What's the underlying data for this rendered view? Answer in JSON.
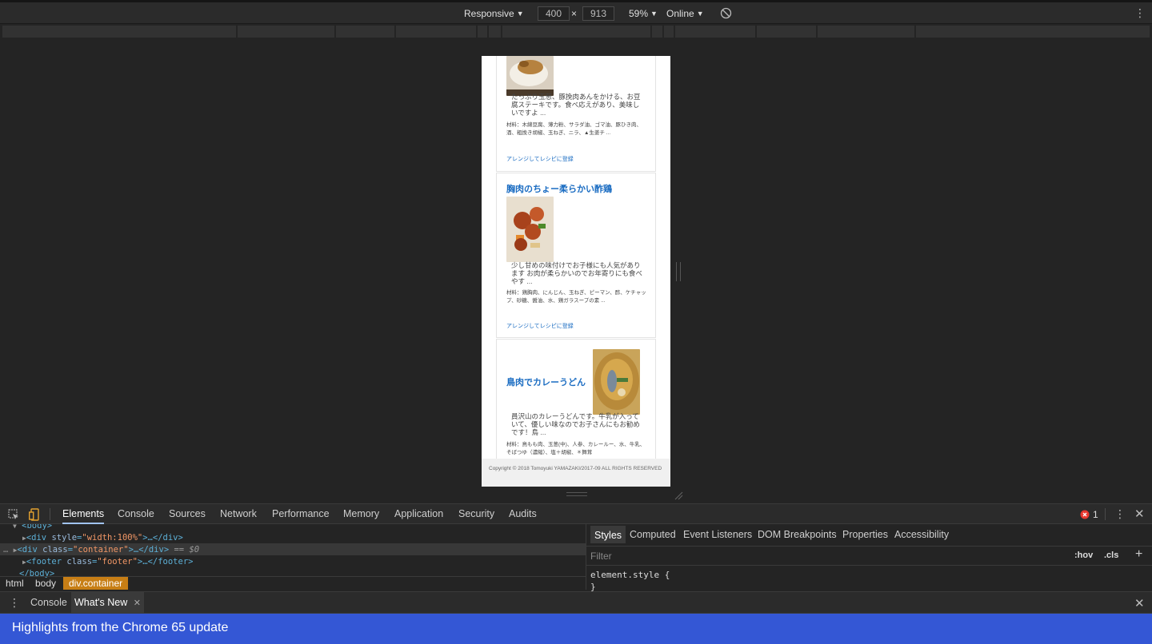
{
  "device_toolbar": {
    "device": "Responsive",
    "width": "400",
    "times": "×",
    "height": "913",
    "zoom": "59%",
    "network": "Online",
    "caret": "▼"
  },
  "page": {
    "cards": [
      {
        "description": "たっぷり玉葱、豚挽肉あんをかける、お豆腐ステーキです。食べ応えがあり、美味しいですよ ...",
        "ingredients": "材料：木綿豆腐、薄力粉、サラダ油、ゴマ油、豚ひき肉、酒、粗挽き胡椒、玉ねぎ、ニラ、▲生姜チ ...",
        "link": "アレンジしてレシピに登録"
      },
      {
        "title": "胸肉のちょー柔らかい酢鶏",
        "description": "少し甘めの味付けでお子様にも人気があります お肉が柔らかいのでお年寄りにも食べやす ...",
        "ingredients": "材料：鶏胸肉、にんじん、玉ねぎ、ピーマン、酢、ケチャップ、砂糖、醤油、水、鶏ガラスープの素 ...",
        "link": "アレンジしてレシピに登録"
      },
      {
        "title": "鳥肉でカレーうどん",
        "description": "員沢山のカレーうどんです。牛乳が入っていて、優しい味なのでお子さんにもお勧めです！鳥 ...",
        "ingredients": "材料：鳥もも肉、玉葱(中)、人参、カレールー、水、牛乳、そばつゆ（濃縮）、塩＋胡椒、＊舞茸"
      }
    ],
    "footer": "Copyright © 2018 Tomoyuki YAMAZAKI/2017-09 ALL RIGHTS RESERVED"
  },
  "devtools": {
    "tabs": [
      "Elements",
      "Console",
      "Sources",
      "Network",
      "Performance",
      "Memory",
      "Application",
      "Security",
      "Audits"
    ],
    "error_count": "1",
    "dom": {
      "line0": "<body>",
      "line1_tag_open": "<div ",
      "line1_attr": "style",
      "line1_val": "\"width:100%\"",
      "line1_rest": ">…</div>",
      "line2_tag_open": "<div ",
      "line2_attr": "class",
      "line2_val": "\"container\"",
      "line2_rest": ">…</div>",
      "line2_marker": " == $0",
      "line3_tag_open": "<footer ",
      "line3_attr": "class",
      "line3_val": "\"footer\"",
      "line3_rest": ">…</footer>",
      "line4": "</body>",
      "equals": "="
    },
    "breadcrumbs": [
      "html",
      "body",
      "div.container"
    ],
    "styles_tabs": [
      "Styles",
      "Computed",
      "Event Listeners",
      "DOM Breakpoints",
      "Properties",
      "Accessibility"
    ],
    "filter_placeholder": "Filter",
    "hov": ":hov",
    "cls": ".cls",
    "code_line1": "element.style {",
    "code_line2": "}",
    "drawer_tabs": [
      "Console",
      "What's New"
    ],
    "banner": "Highlights from the Chrome 65 update"
  },
  "colors": {
    "link": "#1a6cc2",
    "breadcrumb_active": "#c77e15",
    "banner": "#3457d5",
    "error": "#e8382f"
  }
}
